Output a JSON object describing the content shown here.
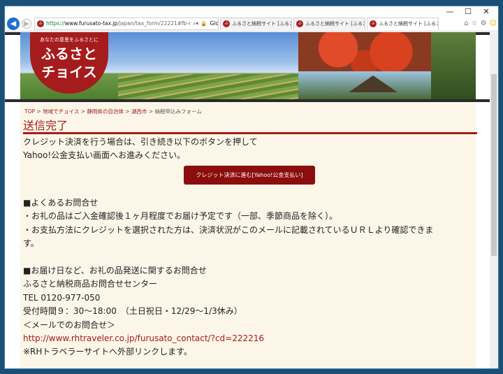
{
  "window": {
    "controls": [
      "—",
      "☐",
      "✕"
    ]
  },
  "browser": {
    "address": {
      "scheme": "https://",
      "host": "www.furusato-tax.jp",
      "path": "/japan/tax_form/22221#fb-r",
      "cert": "GlobalSign によって認証"
    },
    "tabs": [
      {
        "title": "ふるさと納税サイト [ふるさとチョイ..."
      },
      {
        "title": "ふるさと納税サイト [ふるさとチョイ..."
      },
      {
        "title": "ふるさと納税サイト [ふるさとチ..."
      }
    ],
    "favicon_text": "ふ",
    "accent": "#a31c1c"
  },
  "logo": {
    "tagline": "あなたの意思をふるさとに",
    "line1": "ふるさと",
    "line2": "チョイス"
  },
  "breadcrumb": [
    {
      "label": "TOP"
    },
    {
      "label": "地域でチョイス"
    },
    {
      "label": "静岡県の自治体"
    },
    {
      "label": "湖西市"
    },
    {
      "label": "納税申込みフォーム"
    }
  ],
  "heading": "送信完了",
  "lead": {
    "line1": "クレジット決済を行う場合は、引き続き以下のボタンを押して",
    "line2": "Yahoo!公金支払い画面へお進みください。"
  },
  "cta_label": "クレジット決済に進む[Yahoo!公金支払い]",
  "faq": {
    "title1": "■よくあるお問合せ",
    "item1": "・お礼の品はご入金確認後１ヶ月程度でお届け予定です（一部、季節商品を除く）。",
    "item2": "・お支払方法にクレジットを選択された方は、決済状況がこのメールに記載されているＵＲＬより確認できま",
    "item2b": "す。",
    "title2": "■お届け日など、お礼の品発送に関するお問合せ",
    "center": "ふるさと納税商品お問合せセンター",
    "tel": "TEL 0120-977-050",
    "hours": "受付時間９：30～18:00　（土日祝日・12/29～1/3休み）",
    "mail_title": "＜メールでのお問合せ＞",
    "link": "http://www.rhtraveler.co.jp/furusato_contact/?cd=222216",
    "note": "※RHトラベラーサイトへ外部リンクします。"
  }
}
